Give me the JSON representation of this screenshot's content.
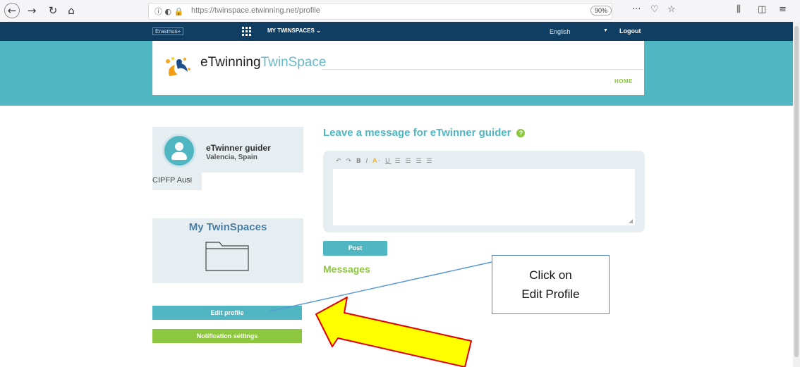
{
  "browser": {
    "url": "https://twinspace.etwinning.net/profile",
    "zoom": "90%",
    "overflow": "···"
  },
  "top_nav": {
    "erasmus": "Erasmus+",
    "my_twinspaces": "MY TWINSPACES",
    "language": "English",
    "logout": "Logout"
  },
  "header": {
    "logo_part1": "eTwinning",
    "logo_part2": "TwinSpace",
    "home": "HOME"
  },
  "profile": {
    "name": "eTwinner guider",
    "location": "Valencia, Spain",
    "school": "CIPFP Ausi"
  },
  "sidebar": {
    "twinspaces_title": "My TwinSpaces",
    "edit_profile": "Edit profile",
    "notification_settings": "Notification settings"
  },
  "main": {
    "message_title": "Leave a message for eTwinner guider",
    "post_label": "Post",
    "messages_heading": "Messages"
  },
  "callout": {
    "line1": "Click on",
    "line2": "Edit Profile"
  },
  "colors": {
    "teal": "#4fb6c2",
    "green": "#8dc63f",
    "navy": "#0f3e62",
    "arrow_fill": "#ffff00",
    "arrow_stroke": "#e00000"
  }
}
